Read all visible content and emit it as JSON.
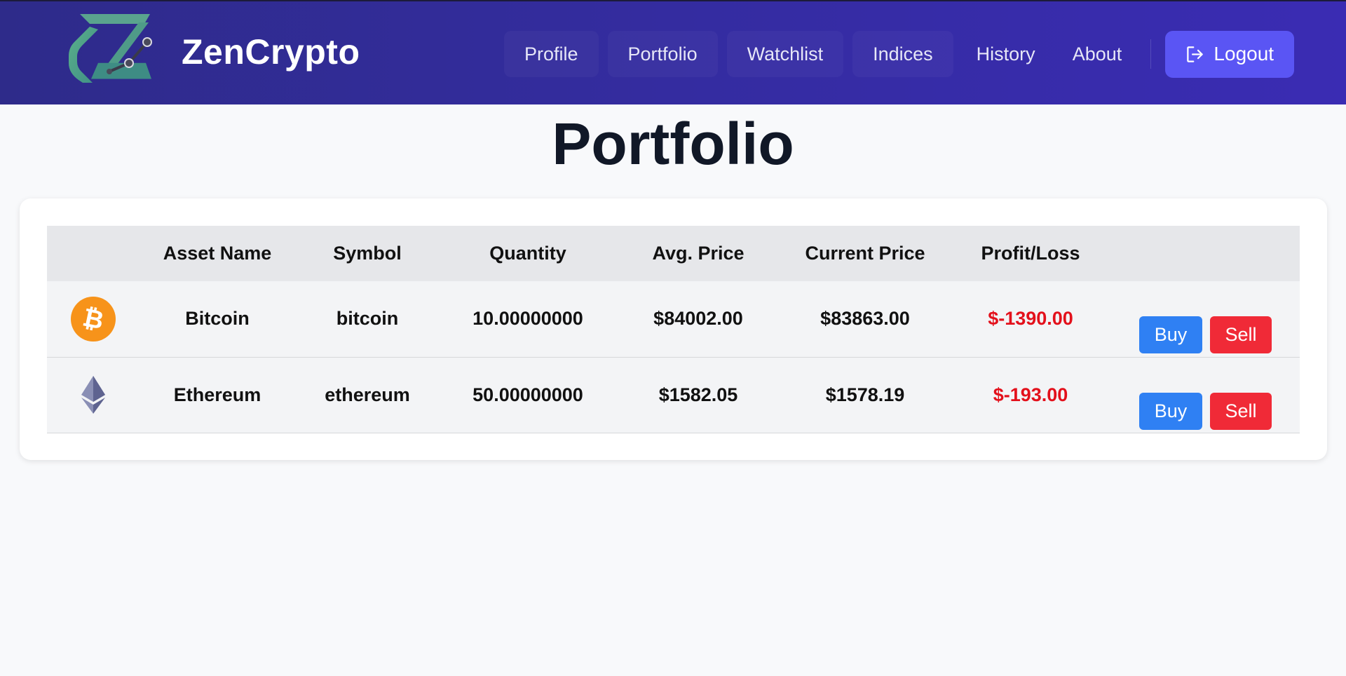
{
  "brand": {
    "name": "ZenCrypto"
  },
  "nav": {
    "items": [
      {
        "label": "Profile"
      },
      {
        "label": "Portfolio"
      },
      {
        "label": "Watchlist"
      },
      {
        "label": "Indices"
      },
      {
        "label": "History"
      },
      {
        "label": "About"
      }
    ],
    "logout_label": "Logout"
  },
  "page": {
    "title": "Portfolio"
  },
  "table": {
    "headers": [
      "",
      "Asset Name",
      "Symbol",
      "Quantity",
      "Avg. Price",
      "Current Price",
      "Profit/Loss",
      ""
    ],
    "rows": [
      {
        "icon": "bitcoin-icon",
        "name": "Bitcoin",
        "symbol": "bitcoin",
        "quantity": "10.00000000",
        "avg_price": "$84002.00",
        "current_price": "$83863.00",
        "profit_loss": "$-1390.00",
        "buy_label": "Buy",
        "sell_label": "Sell"
      },
      {
        "icon": "ethereum-icon",
        "name": "Ethereum",
        "symbol": "ethereum",
        "quantity": "50.00000000",
        "avg_price": "$1582.05",
        "current_price": "$1578.19",
        "profit_loss": "$-193.00",
        "buy_label": "Buy",
        "sell_label": "Sell"
      }
    ]
  },
  "colors": {
    "navbar": "#342ca0",
    "logout_button": "#5a55f4",
    "buy_button": "#2f80f3",
    "sell_button": "#f02a37",
    "loss_text": "#e3101b",
    "bitcoin": "#f7931a"
  }
}
